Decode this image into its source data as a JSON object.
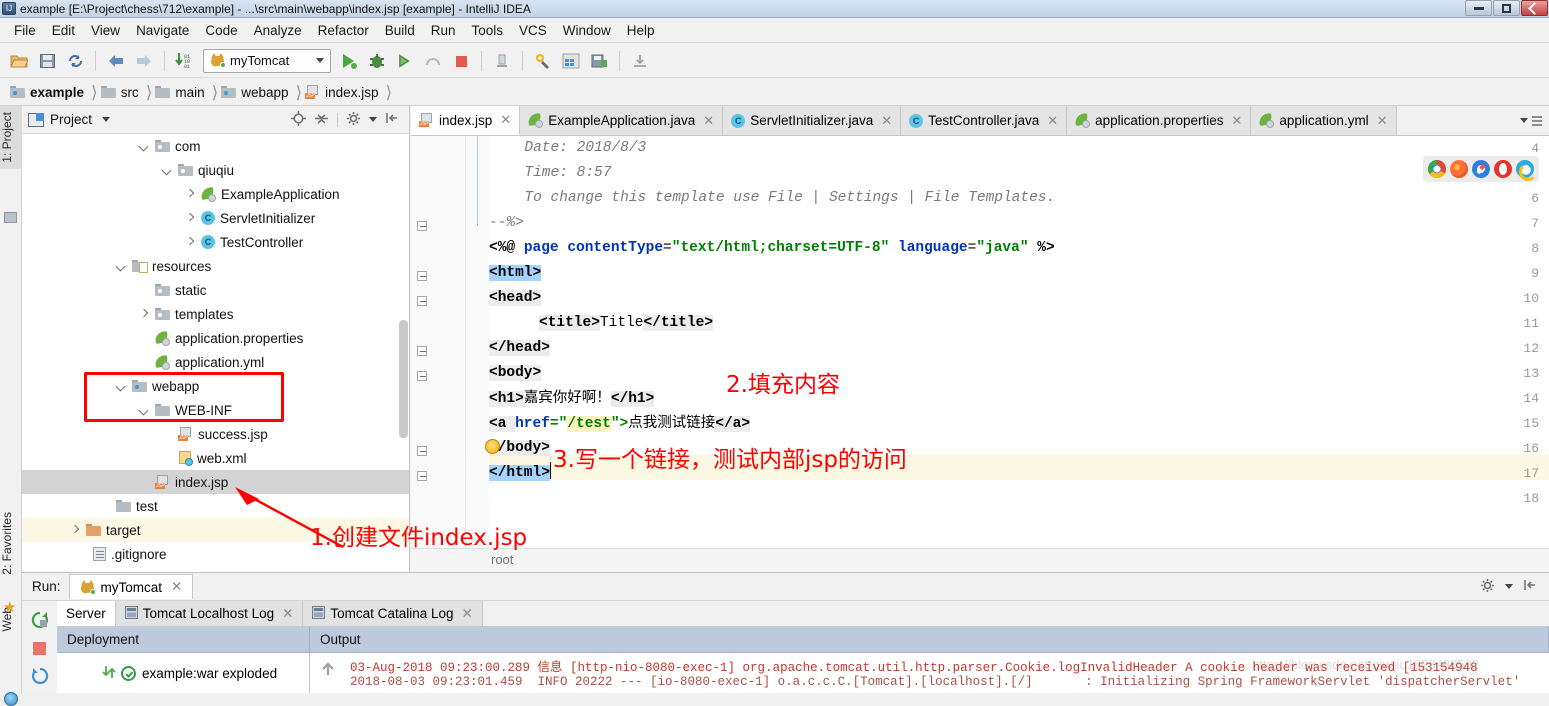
{
  "window": {
    "title": "example [E:\\Project\\chess\\712\\example] - ...\\src\\main\\webapp\\index.jsp [example] - IntelliJ IDEA",
    "app_badge": "IJ",
    "controls": {
      "minimize": "minimize-window",
      "maximize": "maximize-window",
      "close": "close-window"
    }
  },
  "menubar": [
    {
      "label": "File"
    },
    {
      "label": "Edit"
    },
    {
      "label": "View"
    },
    {
      "label": "Navigate"
    },
    {
      "label": "Code"
    },
    {
      "label": "Analyze"
    },
    {
      "label": "Refactor"
    },
    {
      "label": "Build"
    },
    {
      "label": "Run"
    },
    {
      "label": "Tools"
    },
    {
      "label": "VCS"
    },
    {
      "label": "Window"
    },
    {
      "label": "Help"
    }
  ],
  "toolbar": {
    "open_tooltip": "Open",
    "save_tooltip": "Save All",
    "sync_tooltip": "Synchronize",
    "back_tooltip": "Back",
    "forward_tooltip": "Forward",
    "update_tooltip": "Update Project",
    "run_config": "myTomcat",
    "run_tooltip": "Run",
    "debug_tooltip": "Debug",
    "coverage_tooltip": "Run with Coverage",
    "profile_tooltip": "Profile",
    "stop_tooltip": "Stop",
    "settings_tooltip": "Settings",
    "structure_tooltip": "Project Structure"
  },
  "breadcrumbs": [
    {
      "label": "example",
      "icon": "module-icon"
    },
    {
      "label": "src",
      "icon": "folder-icon"
    },
    {
      "label": "main",
      "icon": "folder-icon"
    },
    {
      "label": "webapp",
      "icon": "folder-icon"
    },
    {
      "label": "index.jsp",
      "icon": "jsp-file-icon"
    }
  ],
  "left_strip": [
    {
      "label": "1: Project",
      "active": true
    },
    {
      "label": "2: Favorites",
      "active": false
    },
    {
      "label": "Web",
      "active": false
    }
  ],
  "project_panel": {
    "title": "Project",
    "tree": [
      {
        "label": "com",
        "indent": 3,
        "arrow": "down",
        "icon": "folder"
      },
      {
        "label": "qiuqiu",
        "indent": 4,
        "arrow": "down",
        "icon": "folder"
      },
      {
        "label": "ExampleApplication",
        "indent": 5,
        "arrow": "right",
        "icon": "spring-class"
      },
      {
        "label": "ServletInitializer",
        "indent": 5,
        "arrow": "right",
        "icon": "class"
      },
      {
        "label": "TestController",
        "indent": 5,
        "arrow": "right",
        "icon": "class"
      },
      {
        "label": "resources",
        "indent": 2,
        "arrow": "down",
        "icon": "resource-folder"
      },
      {
        "label": "static",
        "indent": 3,
        "arrow": "none",
        "icon": "folder"
      },
      {
        "label": "templates",
        "indent": 3,
        "arrow": "right",
        "icon": "folder"
      },
      {
        "label": "application.properties",
        "indent": 3,
        "arrow": "none",
        "icon": "spring-file"
      },
      {
        "label": "application.yml",
        "indent": 3,
        "arrow": "none",
        "icon": "spring-file"
      },
      {
        "label": "webapp",
        "indent": 2,
        "arrow": "down",
        "icon": "web-folder"
      },
      {
        "label": "WEB-INF",
        "indent": 3,
        "arrow": "down",
        "icon": "folder"
      },
      {
        "label": "success.jsp",
        "indent": 4,
        "arrow": "none",
        "icon": "jsp"
      },
      {
        "label": "web.xml",
        "indent": 4,
        "arrow": "none",
        "icon": "xml"
      },
      {
        "label": "index.jsp",
        "indent": 3,
        "arrow": "none",
        "icon": "jsp",
        "selected": true
      },
      {
        "label": "test",
        "indent": 2,
        "arrow": "none",
        "icon": "folder"
      },
      {
        "label": "target",
        "indent": 1,
        "arrow": "right",
        "icon": "target-folder",
        "highlight": true
      },
      {
        "label": ".gitignore",
        "indent": 2,
        "arrow": "none",
        "icon": "gitignore"
      }
    ]
  },
  "editor": {
    "tabs": [
      {
        "label": "index.jsp",
        "icon": "jsp-file-icon",
        "active": true
      },
      {
        "label": "ExampleApplication.java",
        "icon": "spring-class-icon",
        "active": false
      },
      {
        "label": "ServletInitializer.java",
        "icon": "class-icon",
        "active": false
      },
      {
        "label": "TestController.java",
        "icon": "class-icon",
        "active": false
      },
      {
        "label": "application.properties",
        "icon": "spring-file-icon",
        "active": false
      },
      {
        "label": "application.yml",
        "icon": "spring-file-icon",
        "active": false
      }
    ],
    "line_numbers": [
      "4",
      "5",
      "6",
      "7",
      "8",
      "9",
      "10",
      "11",
      "12",
      "13",
      "14",
      "15",
      "16",
      "17",
      "18"
    ],
    "code": {
      "l4": "  Date: 2018/8/3",
      "l5": "  Time: 8:57",
      "l6": "  To change this template use File | Settings | File Templates.",
      "l7": "--%>",
      "l8_open": "<%@ ",
      "l8_page": "page ",
      "l8_attr1": "contentType",
      "l8_eq1": "=",
      "l8_val1": "\"text/html;charset=UTF-8\"",
      "l8_attr2": " language",
      "l8_eq2": "=",
      "l8_val2": "\"java\"",
      "l8_close": " %>",
      "l9": "<html>",
      "l10": "<head>",
      "l11_open": "<title>",
      "l11_text": "Title",
      "l11_close": "</title>",
      "l12": "</head>",
      "l13": "<body>",
      "l14_open": "<h1>",
      "l14_text": "嘉宾你好啊！",
      "l14_close": "</h1>",
      "l15_a": "<a ",
      "l15_href": "href",
      "l15_eq": "=\"",
      "l15_url": "/test",
      "l15_q": "\">",
      "l15_text": "点我测试链接",
      "l15_close": "</a>",
      "l16": "</body>",
      "l17": "</html>"
    },
    "browsers": [
      "chrome-icon",
      "firefox-icon",
      "safari-icon",
      "opera-icon",
      "edge-icon"
    ],
    "status_root": "root"
  },
  "annotations": [
    {
      "id": "anno-1",
      "text": "1.创建文件index.jsp"
    },
    {
      "id": "anno-2",
      "text": "2.填充内容"
    },
    {
      "id": "anno-3",
      "text": "3.写一个链接，测试内部jsp的访问"
    }
  ],
  "run_panel": {
    "label": "Run:",
    "config_tab": "myTomcat",
    "log_tabs": [
      {
        "label": "Server",
        "active": true,
        "closable": false
      },
      {
        "label": "Tomcat Localhost Log",
        "active": false,
        "closable": true
      },
      {
        "label": "Tomcat Catalina Log",
        "active": false,
        "closable": true
      }
    ],
    "columns": {
      "deployment": "Deployment",
      "output": "Output"
    },
    "deployment_row": {
      "label": "example:war exploded",
      "status": "deployed-ok"
    },
    "console_lines": [
      "03-Aug-2018 09:23:00.289 信息 [http-nio-8080-exec-1] org.apache.tomcat.util.http.parser.Cookie.logInvalidHeader A cookie header was received [153154948",
      "2018-08-03 09:23:01.459  INFO 20222 --- [io-8080-exec-1] o.a.c.c.C.[Tomcat].[localhost].[/]       : Initializing Spring FrameworkServlet 'dispatcherServlet'"
    ],
    "watermark": "https://blog.csdn.net/qiuqiu1628480502"
  },
  "colors": {
    "annotation_red": "#ff0000",
    "selection_blue": "#a6d2ff",
    "highlight_yellow": "#fcf8e3",
    "header_blue": "#bdcade",
    "log_red": "#c0392b"
  }
}
